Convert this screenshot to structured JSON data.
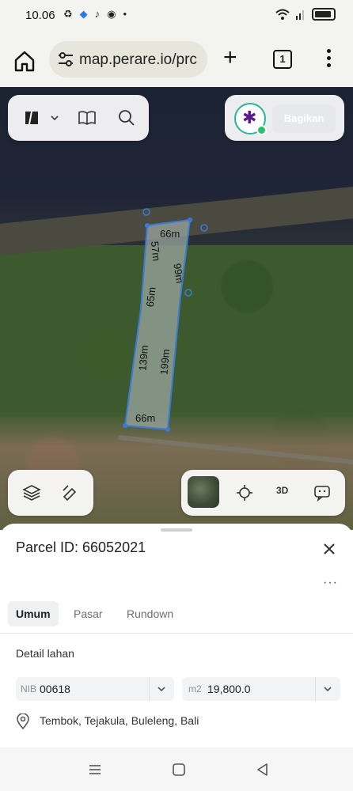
{
  "status_bar": {
    "time": "10.06",
    "left_icons": [
      "recycle-icon",
      "blue-dot-icon",
      "tiktok-icon",
      "chrome-icon",
      "dot-icon"
    ],
    "right_icons": [
      "wifi-icon",
      "signal-icon",
      "battery-icon"
    ]
  },
  "browser": {
    "url": "map.perare.io/prc",
    "tab_count": "1",
    "icons": [
      "home-icon",
      "tune-icon",
      "plus-icon",
      "tabs-icon",
      "more-vertical-icon"
    ]
  },
  "map": {
    "top_toolbar_icons": [
      "map-style-icon",
      "chevron-down-icon",
      "book-icon",
      "search-icon"
    ],
    "share_label": "Bagikan",
    "edge_labels": {
      "top": "66m",
      "left_top": "57m",
      "right_top": "99m",
      "left_mid": "65m",
      "left_bottom": "139m",
      "right_bottom": "199m",
      "bottom": "66m"
    },
    "bottom_left_icons": [
      "layers-icon",
      "pencil-icon"
    ],
    "bottom_right_icons": [
      "satellite-thumbnail-icon",
      "crosshair-icon",
      "3d-icon",
      "feedback-icon"
    ],
    "view_3d_label": "3D"
  },
  "sheet": {
    "title": "Parcel ID: 66052021",
    "more": "···",
    "tabs": [
      "Umum",
      "Pasar",
      "Rundown"
    ],
    "active_tab": "Umum",
    "section_title": "Detail lahan",
    "nib": {
      "prefix": "NIB",
      "value": "00618"
    },
    "area": {
      "prefix": "m2",
      "value": "19,800.0"
    },
    "address": "Tembok, Tejakula, Buleleng, Bali"
  },
  "colors": {
    "parcel_fill": "#9aa6a0",
    "parcel_stroke": "#3a7bd5",
    "share_button": "#e7e8ea",
    "accent_green": "#2db39a"
  },
  "nav_icons": [
    "recent-apps-icon",
    "home-square-icon",
    "back-icon"
  ]
}
